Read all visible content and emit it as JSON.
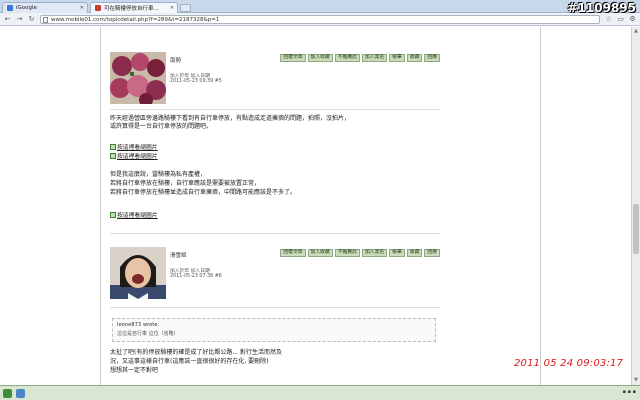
{
  "watermark": "#1109895",
  "tabs": [
    {
      "label": "iGoogle",
      "favicon_color": "#3a78d4"
    },
    {
      "label": "可在騎樓停放自行車...",
      "favicon_color": "#cc3b2e"
    }
  ],
  "toolbar": {
    "back": "←",
    "forward": "→",
    "reload": "↻",
    "url": "www.mobile01.com/topicdetail.php?f=289&t=2187328&p=1",
    "star": "☆",
    "page_menu": "▭",
    "tools_menu": "⚙"
  },
  "post1": {
    "username": "南勢",
    "info_line1": "加入於年  加入日期",
    "info_line2": "2011-05-23 09:39 #5",
    "actions": [
      "回覆文章",
      "加入收藏",
      "不推薦此",
      "加入黑名",
      "檢舉",
      "收藏",
      "回應"
    ],
    "body": [
      "昨天經過營區旁邊路騎樓下看到有自行車停放，有點造成走道擁擠的問題，拍照，沒拍片，",
      "或許算得是一台自行車停放的問題吧。"
    ],
    "image_links": [
      "按這裡看縮圖片",
      "按這裡看縮圖片"
    ],
    "body2": [
      "但是我這麼說，當騎樓為私有產權，",
      "若將自行車停放在騎樓，自行車應該是需要被放置正常，",
      "若將自行車停放在騎樓並造成自行車擁擠，中間路可能應該是不多了。"
    ],
    "image_link3": "按這裡看縮圖片"
  },
  "post2": {
    "username": "滑雪姬",
    "info_line1": "加入於年  加入日期",
    "info_line2": "2011-05-23 07:38 #6",
    "actions": [
      "回覆文章",
      "加入收藏",
      "不推薦此",
      "加入黑名",
      "檢舉",
      "收藏",
      "回應"
    ],
    "quote_author": "leone873 wrote:",
    "quote_text": "這位是自行車 這位（省略）",
    "body": [
      "太扯了吧(有的停放騎樓的確是成了好比鄰公路... 對行生活而然及",
      "況，又這事這樣自行車(這應該一直很很好的存在化, 要刪除)",
      "想想其一定不對吧"
    ]
  },
  "timestamp": "2011 05 24 09:03:17"
}
